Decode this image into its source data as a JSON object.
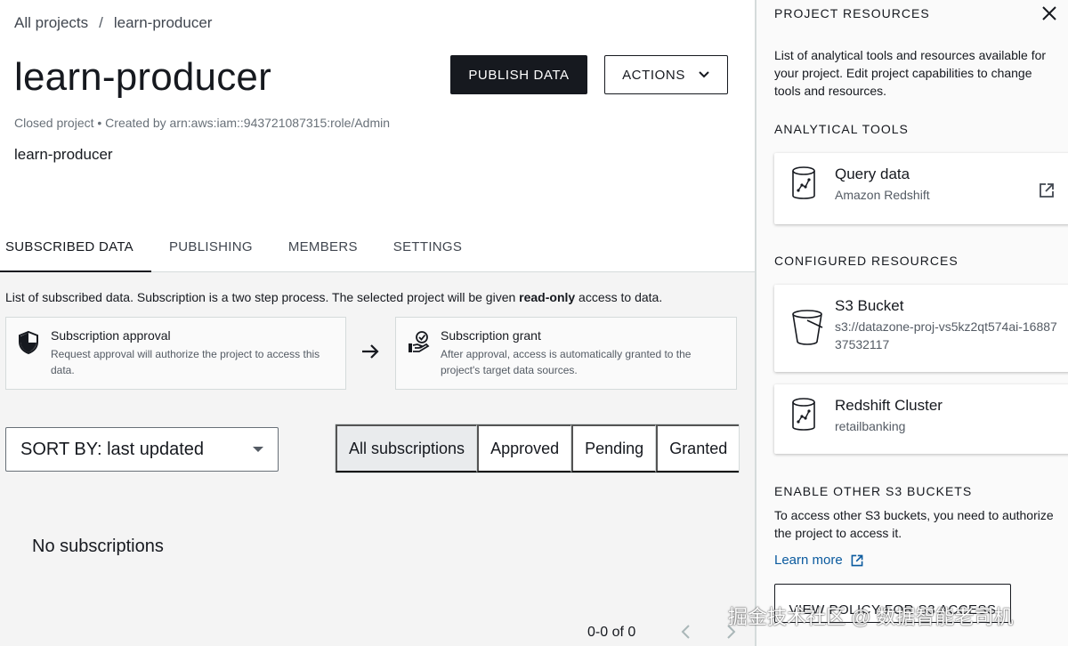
{
  "breadcrumb": {
    "root": "All projects",
    "separator": "/",
    "current": "learn-producer"
  },
  "header": {
    "title": "learn-producer",
    "meta": "Closed project • Created by arn:aws:iam::943721087315:role/Admin",
    "description": "learn-producer",
    "publish_label": "PUBLISH DATA",
    "actions_label": "ACTIONS"
  },
  "tabs": [
    {
      "label": "SUBSCRIBED DATA",
      "active": true
    },
    {
      "label": "PUBLISHING"
    },
    {
      "label": "MEMBERS"
    },
    {
      "label": "SETTINGS"
    }
  ],
  "subscribed": {
    "info_prefix": "List of subscribed data. Subscription is a two step process. The selected project will be given ",
    "info_bold": "read-only",
    "info_suffix": " access to data.",
    "step1": {
      "title": "Subscription approval",
      "text": "Request approval will authorize the project to access this data.",
      "icon": "shield-icon"
    },
    "step2": {
      "title": "Subscription grant",
      "text": "After approval, access is automatically granted to the project's target data sources.",
      "icon": "hand-check-icon"
    },
    "sort_label": "SORT BY: last updated",
    "filters": [
      "All subscriptions",
      "Approved",
      "Pending",
      "Granted"
    ],
    "empty": "No subscriptions",
    "pager": "0-0 of 0"
  },
  "panel": {
    "title": "PROJECT RESOURCES",
    "description": "List of analytical tools and resources available for your project. Edit project capabilities to change tools and resources.",
    "analytical_heading": "ANALYTICAL TOOLS",
    "query": {
      "name": "Query data",
      "sub": "Amazon Redshift"
    },
    "configured_heading": "CONFIGURED RESOURCES",
    "s3": {
      "name": "S3 Bucket",
      "sub": "s3://datazone-proj-vs5kz2qt574ai-1688737532117"
    },
    "redshift": {
      "name": "Redshift Cluster",
      "sub": "retailbanking"
    },
    "enable_heading": "ENABLE OTHER S3 BUCKETS",
    "enable_text": "To access other S3 buckets, you need to authorize the project to access it.",
    "learn_more": "Learn more",
    "view_policy": "VIEW POLICY FOR S3 ACCESS"
  },
  "watermark": "掘金技术社区 @ 数据智能老司机",
  "colors": {
    "primary": "#16191f",
    "link": "#0a5a9e",
    "border": "#d5dbdb"
  }
}
